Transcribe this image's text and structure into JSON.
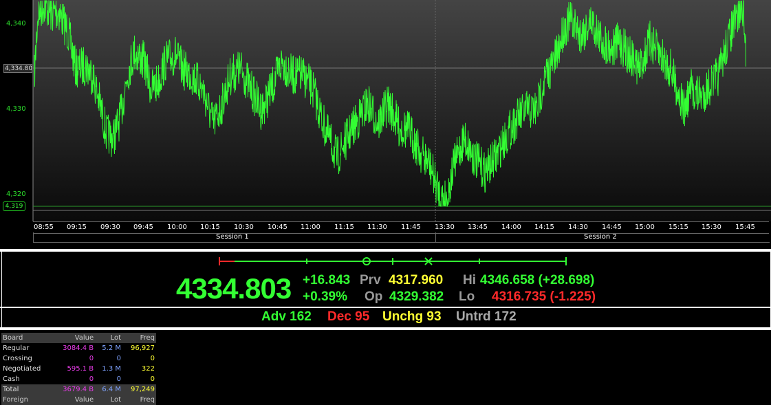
{
  "chart": {
    "y_ticks": [
      "4,340",
      "4,330",
      "4,320"
    ],
    "last_marker": "4,334.80",
    "low_marker": "4,319",
    "time_labels": [
      "08:55",
      "09:15",
      "09:30",
      "09:45",
      "10:00",
      "10:15",
      "10:30",
      "10:45",
      "11:00",
      "11:15",
      "11:30",
      "11:45",
      "13:30",
      "13:45",
      "14:00",
      "14:15",
      "14:30",
      "14:45",
      "15:00",
      "15:15",
      "15:30",
      "15:45"
    ],
    "sessions": [
      "Session 1",
      "Session 2"
    ],
    "line_color": "#33ff33"
  },
  "quote": {
    "last": "4334.803",
    "change": "+16.843",
    "change_pct": "+0.39%",
    "prev_label": "Prv",
    "prev": "4317.960",
    "open_label": "Op",
    "open": "4329.382",
    "high_label": "Hi",
    "high": "4346.658 (+28.698)",
    "low_label": "Lo",
    "low": "4316.735 (-1.225)"
  },
  "breadth": {
    "adv": "Adv 162",
    "dec": "Dec 95",
    "unchg": "Unchg 93",
    "untrd": "Untrd 172"
  },
  "board": {
    "headers": [
      "Board",
      "Value",
      "Lot",
      "Freq"
    ],
    "rows": [
      {
        "name": "Regular",
        "value": "3084.4 B",
        "lot": "5.2 M",
        "freq": "96,927"
      },
      {
        "name": "Crossing",
        "value": "0",
        "lot": "0",
        "freq": "0"
      },
      {
        "name": "Negotiated",
        "value": "595.1 B",
        "lot": "1.3 M",
        "freq": "322"
      },
      {
        "name": "Cash",
        "value": "0",
        "lot": "0",
        "freq": "0"
      }
    ],
    "total": {
      "name": "Total",
      "value": "3679.4 B",
      "lot": "6.4 M",
      "freq": "97,249"
    },
    "foreign_headers": [
      "Foreign",
      "Value",
      "Lot",
      "Freq"
    ]
  }
}
